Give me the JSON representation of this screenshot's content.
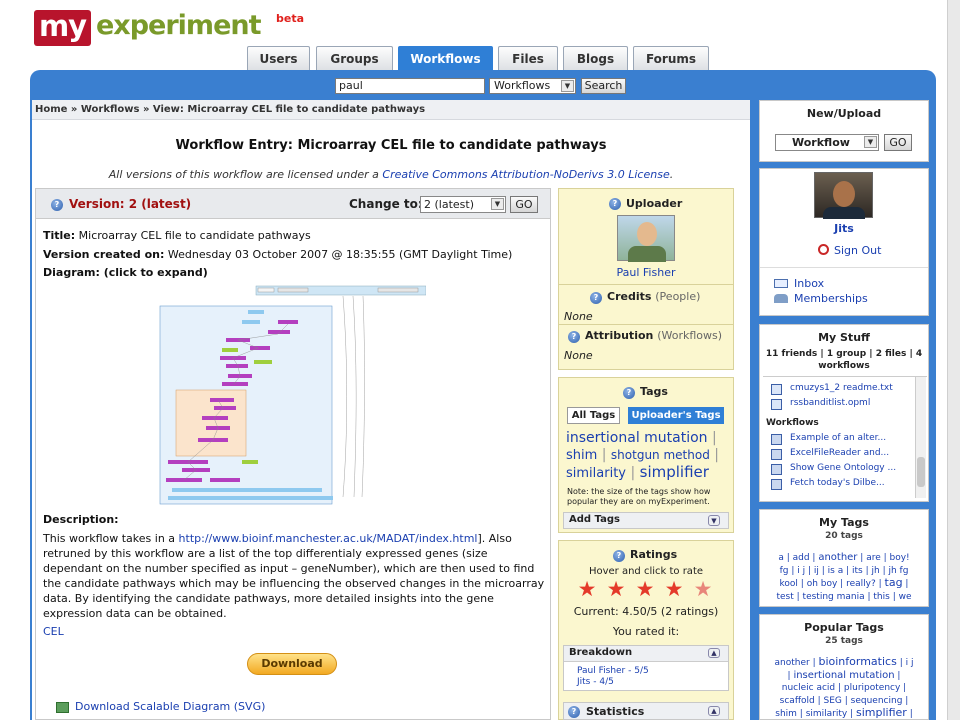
{
  "brand": {
    "my": "my",
    "experiment": "experiment",
    "beta": "beta"
  },
  "nav": {
    "tabs": [
      "Users",
      "Groups",
      "Workflows",
      "Files",
      "Blogs",
      "Forums"
    ],
    "active": "Workflows"
  },
  "search": {
    "value": "paul",
    "scope": "Workflows",
    "button": "Search"
  },
  "breadcrumb": "Home » Workflows » View: Microarray CEL file to candidate pathways",
  "page": {
    "title": "Workflow Entry: Microarray CEL file to candidate pathways",
    "license_prefix": "All versions of this workflow are licensed under a ",
    "license_link": "Creative Commons Attribution-NoDerivs 3.0 License",
    "license_suffix": "."
  },
  "version": {
    "label": "Version: 2 (latest)",
    "change_to": "Change to:",
    "selected": "2 (latest)",
    "go": "GO"
  },
  "details": {
    "title_label": "Title:",
    "title_value": "Microarray CEL file to candidate pathways",
    "created_label": "Version created on:",
    "created_value": "Wednesday 03 October 2007 @ 18:35:55 (GMT Daylight Time)",
    "diagram_label": "Diagram: (click to expand)",
    "description_label": "Description:",
    "description_1": "This workflow takes in a ",
    "description_link": "http://www.bioinf.manchester.ac.uk/MADAT/index.html",
    "description_2": "]. Also retruned by this workflow are a list of the top differentialy expressed genes (size dependant on the number specified as input – geneNumber), which are then used to find the candidate pathways which may be influencing the observed changes in the microarray data. By identifying the candidate pathways, more detailed insights into the gene expression data can be obtained.",
    "tag": "CEL",
    "download": "Download",
    "svg_link": "Download Scalable Diagram (SVG)"
  },
  "uploader": {
    "heading": "Uploader",
    "name": "Paul Fisher"
  },
  "credits": {
    "heading": "Credits",
    "sub": "(People)",
    "value": "None"
  },
  "attribution": {
    "heading": "Attribution",
    "sub": "(Workflows)",
    "value": "None"
  },
  "tags": {
    "heading": "Tags",
    "all_tags": "All Tags",
    "uploader_tags": "Uploader's Tags",
    "cloud": [
      "insertional mutation",
      "shim",
      "shotgun method",
      "similarity",
      "simplifier"
    ],
    "note": "Note: the size of the tags show how popular they are on myExperiment.",
    "add_tags": "Add Tags"
  },
  "ratings": {
    "heading": "Ratings",
    "hint": "Hover and click to rate",
    "stars": 4.5,
    "current": "Current: 4.50/5 (2 ratings)",
    "you_rated": "You rated it:",
    "breakdown_heading": "Breakdown",
    "breakdown": [
      "Paul Fisher - 5/5",
      "Jits - 4/5"
    ],
    "statistics": "Statistics"
  },
  "new_upload": {
    "heading": "New/Upload",
    "selected": "Workflow",
    "go": "GO"
  },
  "user": {
    "name": "Jits",
    "sign_out": "Sign Out",
    "inbox": "Inbox",
    "memberships": "Memberships"
  },
  "my_stuff": {
    "heading": "My Stuff",
    "summary_a": "11 friends",
    "summary_b": "1 group",
    "summary_c": "2 files",
    "summary_d": "4",
    "summary_e": "workflows",
    "files": [
      "cmuzys1_2 readme.txt",
      "rssbanditlist.opml"
    ],
    "workflows_heading": "Workflows",
    "workflows": [
      "Example of an alter...",
      "ExcelFileReader and...",
      "Show Gene Ontology ...",
      "Fetch today's Dilbe..."
    ]
  },
  "my_tags": {
    "heading": "My Tags",
    "count": "20 tags",
    "row1": [
      "a",
      "add",
      "another",
      "are",
      "boy!"
    ],
    "row2": [
      "fg",
      "i j",
      "ij",
      "is a",
      "its",
      "jh",
      "jh fg"
    ],
    "row3": [
      "kool",
      "oh boy",
      "really?",
      "tag"
    ],
    "row4": [
      "test",
      "testing mania",
      "this",
      "we"
    ]
  },
  "popular_tags": {
    "heading": "Popular Tags",
    "count": "25 tags",
    "row1": [
      "another",
      "bioinformatics",
      "i j"
    ],
    "row2": [
      "insertional mutation"
    ],
    "row3": [
      "nucleic acid",
      "pluripotency"
    ],
    "row4": [
      "scaffold",
      "SEG",
      "sequencing"
    ],
    "row5": [
      "shim",
      "similarity",
      "simplifier"
    ]
  },
  "colors": {
    "accent": "#3a7fd0",
    "brand_red": "#b8142c",
    "brand_green": "#7a9a2a",
    "version_red": "#a11010",
    "panel_yellow": "#fbf7cf"
  }
}
